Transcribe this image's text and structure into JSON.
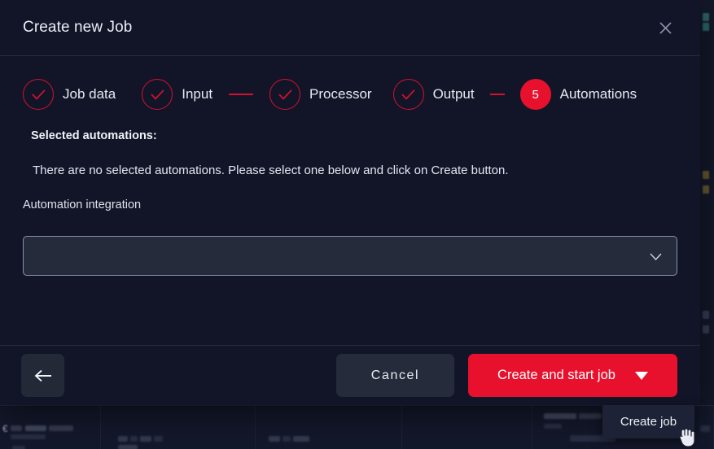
{
  "modal": {
    "title": "Create new Job",
    "close_icon": "close-icon"
  },
  "stepper": {
    "steps": [
      {
        "label": "Job data",
        "state": "done",
        "mark": "✓",
        "connector_after": false,
        "connector_width": 0
      },
      {
        "label": "Input",
        "state": "done",
        "mark": "✓",
        "connector_after": true,
        "connector_width": 30
      },
      {
        "label": "Processor",
        "state": "done",
        "mark": "✓",
        "connector_after": false,
        "connector_width": 0
      },
      {
        "label": "Output",
        "state": "done",
        "mark": "✓",
        "connector_after": true,
        "connector_width": 18
      },
      {
        "label": "Automations",
        "state": "active",
        "mark": "5",
        "connector_after": false,
        "connector_width": 0
      }
    ]
  },
  "body": {
    "selected_title": "Selected automations:",
    "empty_message": "There are no selected automations. Please select one below and click on Create button.",
    "field_label": "Automation integration",
    "select": {
      "value": "",
      "placeholder": "",
      "chevron_icon": "chevron-down-icon"
    }
  },
  "footer": {
    "back_icon": "←",
    "cancel_label": "Cancel",
    "create_label": "Create and start job",
    "split_caret_icon": "caret-down-icon"
  },
  "dropdown": {
    "items": [
      {
        "label": "Create job"
      }
    ]
  },
  "colors": {
    "accent_red": "#e8112d",
    "step_done_red": "#d4112f",
    "modal_bg": "#121527",
    "field_bg": "#262b3b",
    "button_neutral": "#262b3b",
    "text_primary": "#e9ecf5"
  }
}
